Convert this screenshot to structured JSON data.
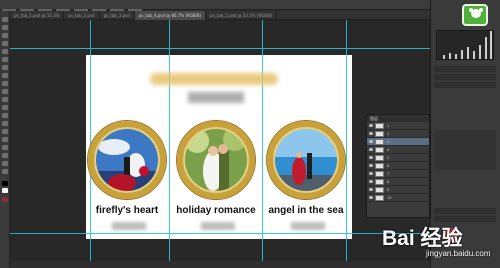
{
  "window": {
    "tabs": [
      {
        "label": "ps_tab_1.psd @ 33.3%"
      },
      {
        "label": "ps_tab_2.psd"
      },
      {
        "label": "ps_tab_3.psd"
      },
      {
        "label": "ps_tab_4.psd @ 66.7% (RGB/8)"
      },
      {
        "label": "ps_tab_5.psd @ 33.3% (RGB/8)"
      }
    ]
  },
  "document": {
    "cards": [
      {
        "caption": "firefly's heart"
      },
      {
        "caption": "holiday romance"
      },
      {
        "caption": "angel in the sea"
      }
    ]
  },
  "layers_panel": {
    "title": "图层",
    "rows": [
      {
        "label": "1"
      },
      {
        "label": "2"
      },
      {
        "label": "3"
      },
      {
        "label": "4"
      },
      {
        "label": "5"
      },
      {
        "label": "6"
      },
      {
        "label": "7"
      },
      {
        "label": "8"
      },
      {
        "label": "9"
      },
      {
        "label": "10"
      }
    ]
  },
  "watermark": {
    "brand": "Bai 经验",
    "url": "jingyan.baidu.com"
  },
  "colors": {
    "guide": "#22c4d8",
    "frame_gold": "#c9a13b",
    "logo_green": "#4fb13c"
  }
}
